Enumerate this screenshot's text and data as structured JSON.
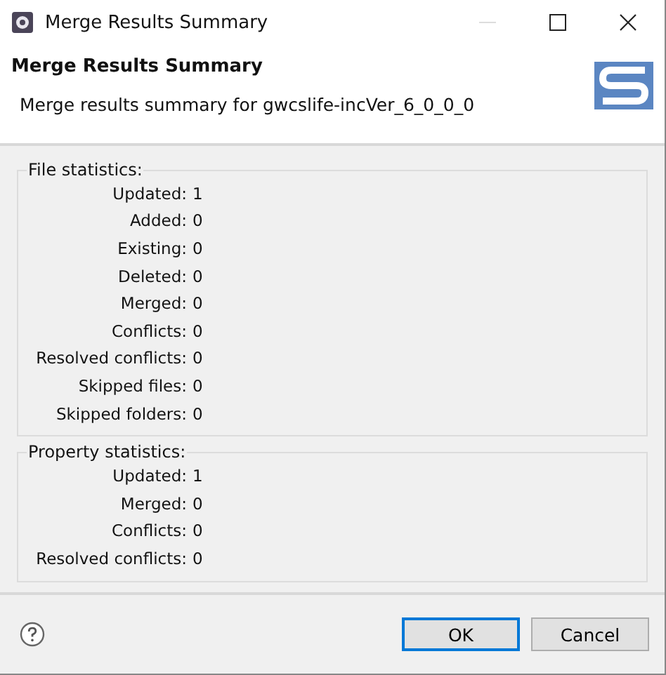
{
  "window": {
    "title": "Merge Results Summary"
  },
  "header": {
    "title": "Merge Results Summary",
    "description": "Merge results summary for gwcslife-incVer_6_0_0_0"
  },
  "groups": [
    {
      "title": "File statistics:",
      "rows": [
        {
          "label": "Updated:",
          "value": "1"
        },
        {
          "label": "Added:",
          "value": "0"
        },
        {
          "label": "Existing:",
          "value": "0"
        },
        {
          "label": "Deleted:",
          "value": "0"
        },
        {
          "label": "Merged:",
          "value": "0"
        },
        {
          "label": "Conflicts:",
          "value": "0"
        },
        {
          "label": "Resolved conflicts:",
          "value": "0"
        },
        {
          "label": "Skipped files:",
          "value": "0"
        },
        {
          "label": "Skipped folders:",
          "value": "0"
        }
      ]
    },
    {
      "title": "Property statistics:",
      "rows": [
        {
          "label": "Updated:",
          "value": "1"
        },
        {
          "label": "Merged:",
          "value": "0"
        },
        {
          "label": "Conflicts:",
          "value": "0"
        },
        {
          "label": "Resolved conflicts:",
          "value": "0"
        }
      ]
    }
  ],
  "buttons": [
    {
      "label": "OK",
      "default": true
    },
    {
      "label": "Cancel",
      "default": false
    }
  ]
}
